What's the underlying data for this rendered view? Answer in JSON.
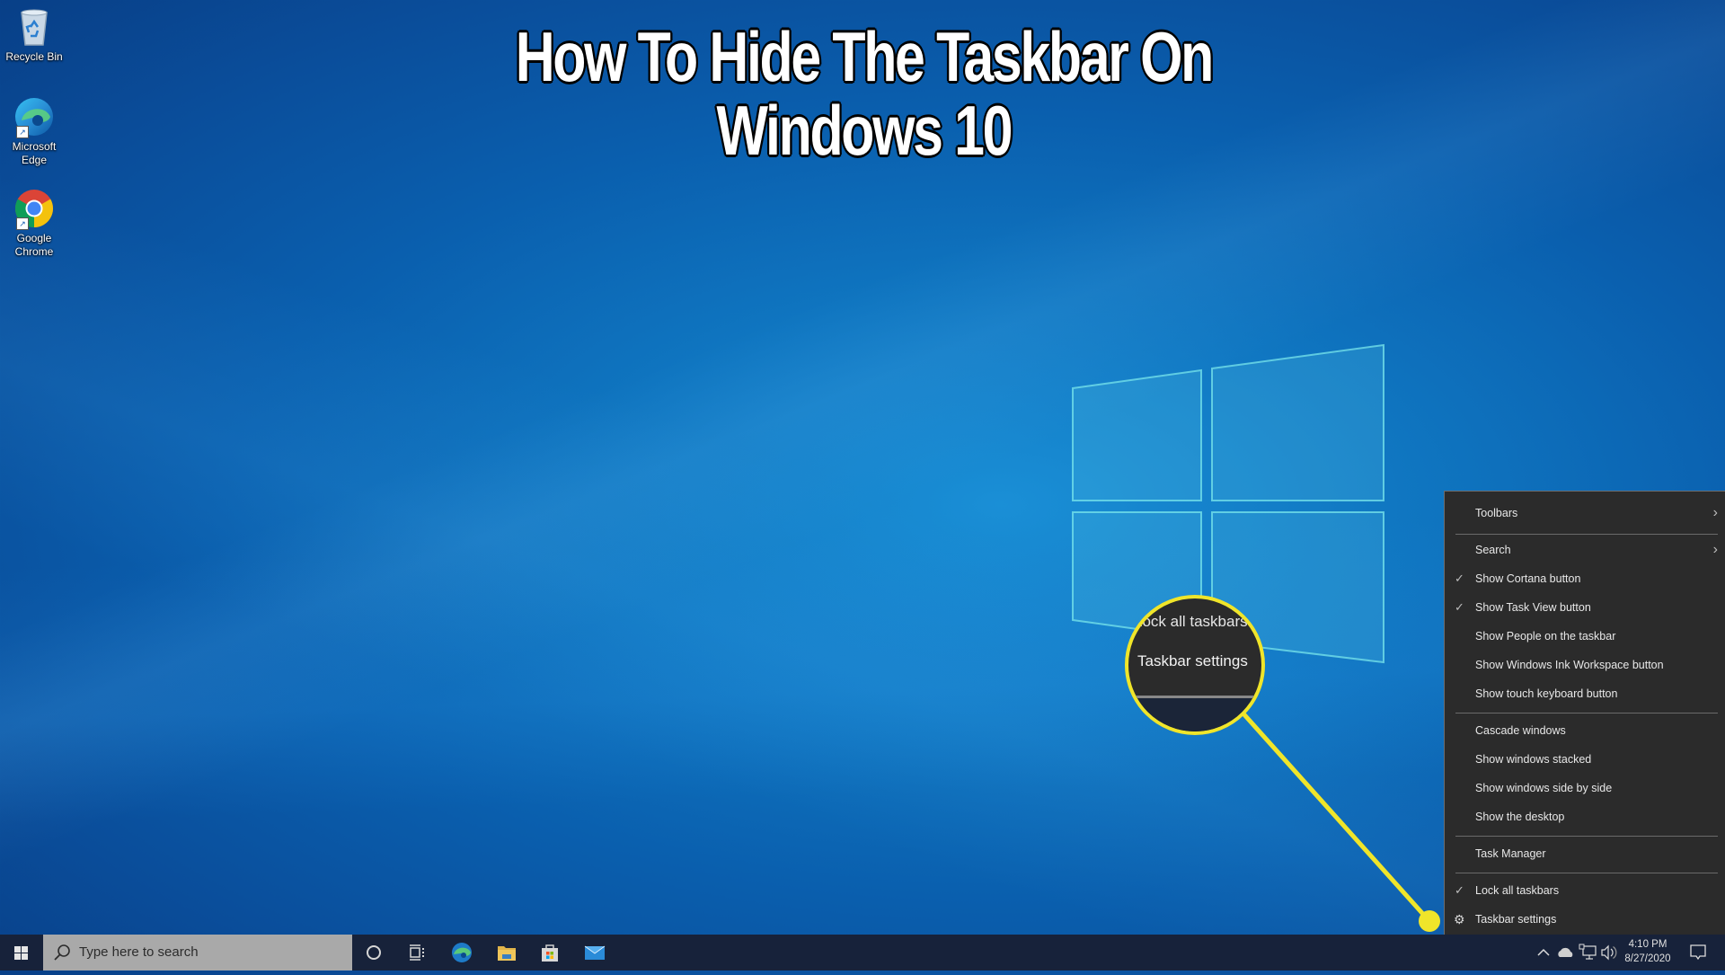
{
  "overlay": {
    "title_line1": "How To Hide The Taskbar On",
    "title_line2": "Windows 10",
    "callout": {
      "line1": "Lock all taskbars",
      "line2": "Taskbar settings",
      "highlight_color": "#f0e52a"
    }
  },
  "desktop": {
    "icons": [
      {
        "label": "Recycle Bin",
        "icon": "recycle-bin-icon"
      },
      {
        "label_line1": "Microsoft",
        "label_line2": "Edge",
        "icon": "edge-icon"
      },
      {
        "label_line1": "Google",
        "label_line2": "Chrome",
        "icon": "chrome-icon"
      }
    ]
  },
  "context_menu": {
    "items": [
      {
        "label": "Toolbars",
        "submenu": true,
        "checked": false
      },
      {
        "label": "Search",
        "submenu": true,
        "checked": false
      },
      {
        "label": "Show Cortana button",
        "checked": true
      },
      {
        "label": "Show Task View button",
        "checked": true
      },
      {
        "label": "Show People on the taskbar",
        "checked": false
      },
      {
        "label": "Show Windows Ink Workspace button",
        "checked": false
      },
      {
        "label": "Show touch keyboard button",
        "checked": false
      },
      {
        "label": "Cascade windows",
        "checked": false
      },
      {
        "label": "Show windows stacked",
        "checked": false
      },
      {
        "label": "Show windows side by side",
        "checked": false
      },
      {
        "label": "Show the desktop",
        "checked": false
      },
      {
        "label": "Task Manager",
        "checked": false
      },
      {
        "label": "Lock all taskbars",
        "checked": true
      },
      {
        "label": "Taskbar settings",
        "icon": "gear-icon"
      }
    ],
    "check_glyph": "✓",
    "submenu_glyph": "›",
    "gear_glyph": "⚙"
  },
  "taskbar": {
    "search_placeholder": "Type here to search",
    "pinned": [
      "cortana",
      "task-view",
      "edge",
      "file-explorer",
      "microsoft-store",
      "mail"
    ],
    "tray": {
      "time": "4:10 PM",
      "date": "8/27/2020"
    }
  }
}
